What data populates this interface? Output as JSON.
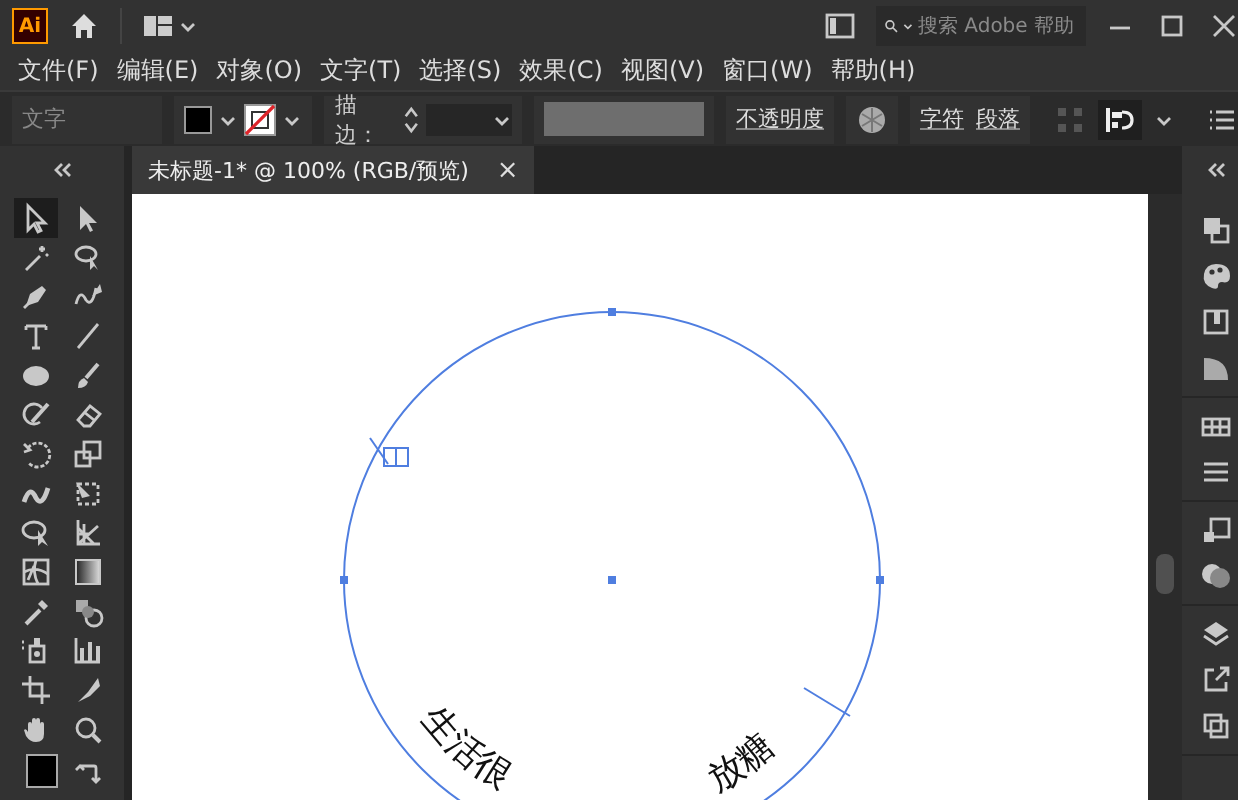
{
  "title_bar": {
    "logo": "Ai",
    "search": {
      "placeholder": "搜索 Adobe 帮助"
    }
  },
  "menu_bar": [
    "文件(F)",
    "编辑(E)",
    "对象(O)",
    "文字(T)",
    "选择(S)",
    "效果(C)",
    "视图(V)",
    "窗口(W)",
    "帮助(H)"
  ],
  "control_bar": {
    "mode_label": "文字",
    "stroke_label": "描边：",
    "opacity_link": "不透明度",
    "character_link": "字符",
    "paragraph_link": "段落"
  },
  "document_tabs": [
    {
      "title": "未标题-1* @ 100% (RGB/预览)",
      "close": "×",
      "selected": true
    }
  ],
  "artboard": {
    "path_texts": [
      "生活很",
      "放糖"
    ]
  }
}
